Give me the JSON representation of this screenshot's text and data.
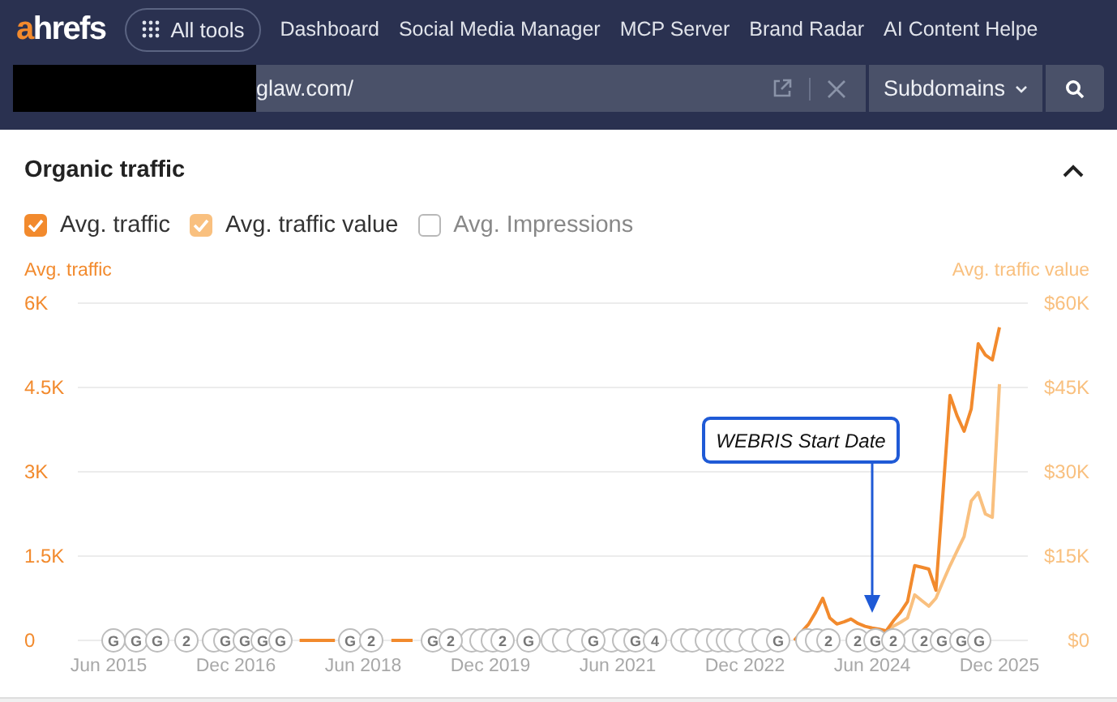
{
  "header": {
    "logo": {
      "accent": "a",
      "rest": "hrefs"
    },
    "all_tools": "All tools",
    "nav": [
      "Dashboard",
      "Social Media Manager",
      "MCP Server",
      "Brand Radar",
      "AI Content Helpe"
    ],
    "search": {
      "value": "glaw.com/",
      "mode": "Subdomains"
    }
  },
  "panel": {
    "title": "Organic traffic",
    "expanded": true,
    "legend": [
      {
        "label": "Avg. traffic",
        "checked": true,
        "color": "#f28a2d"
      },
      {
        "label": "Avg. traffic value",
        "checked": true,
        "color": "#f9c07f"
      },
      {
        "label": "Avg. Impressions",
        "checked": false,
        "color": "#b8b8b8"
      }
    ],
    "chart_data": {
      "type": "line",
      "ylabel": "Avg. traffic",
      "y2label": "Avg. traffic value",
      "categories": [
        "Jun 2015",
        null,
        null,
        null,
        null,
        null,
        null,
        null,
        null,
        null,
        null,
        null,
        null,
        null,
        null,
        null,
        null,
        null,
        "Dec 2016",
        null,
        null,
        null,
        null,
        null,
        null,
        null,
        null,
        null,
        null,
        null,
        null,
        null,
        null,
        null,
        null,
        null,
        "Jun 2018",
        null,
        null,
        null,
        null,
        null,
        null,
        null,
        null,
        null,
        null,
        null,
        null,
        null,
        null,
        null,
        null,
        null,
        "Dec 2019",
        null,
        null,
        null,
        null,
        null,
        null,
        null,
        null,
        null,
        null,
        null,
        null,
        null,
        null,
        null,
        null,
        null,
        "Jun 2021",
        null,
        null,
        null,
        null,
        null,
        null,
        null,
        null,
        null,
        null,
        null,
        null,
        null,
        null,
        null,
        null,
        null,
        "Dec 2022",
        null,
        null,
        null,
        null,
        null,
        null,
        null,
        null,
        null,
        null,
        null,
        null,
        null,
        null,
        null,
        null,
        null,
        "Jun 2024",
        null,
        null,
        null,
        null,
        null,
        null,
        null,
        null,
        null,
        null,
        null,
        null,
        null,
        null,
        null,
        null,
        null,
        "Dec 2025"
      ],
      "series": [
        {
          "color": "#f9c07f",
          "axis": "y2",
          "values": [
            null,
            null,
            null,
            null,
            null,
            null,
            null,
            null,
            null,
            null,
            null,
            null,
            null,
            null,
            null,
            null,
            null,
            null,
            null,
            null,
            null,
            null,
            null,
            null,
            null,
            null,
            null,
            null,
            null,
            null,
            null,
            null,
            null,
            null,
            null,
            null,
            null,
            null,
            null,
            null,
            null,
            null,
            null,
            null,
            null,
            null,
            null,
            null,
            null,
            null,
            null,
            null,
            null,
            null,
            null,
            null,
            null,
            null,
            null,
            null,
            null,
            null,
            null,
            null,
            null,
            null,
            null,
            null,
            null,
            null,
            null,
            null,
            null,
            null,
            null,
            null,
            null,
            null,
            null,
            null,
            null,
            null,
            null,
            null,
            null,
            null,
            null,
            null,
            null,
            null,
            null,
            null,
            null,
            null,
            null,
            null,
            null,
            null,
            null,
            null,
            null,
            null,
            null,
            null,
            null,
            null,
            null,
            null,
            null,
            0,
            1700,
            2500,
            3200,
            4000,
            8100,
            7100,
            6100,
            7500,
            10400,
            13300,
            15900,
            18500,
            24800,
            26300,
            22500,
            21900,
            45600
          ]
        },
        {
          "color": "#f28a2d",
          "values": [
            null,
            null,
            null,
            null,
            null,
            null,
            null,
            null,
            null,
            null,
            null,
            null,
            null,
            null,
            null,
            null,
            null,
            null,
            null,
            null,
            null,
            null,
            null,
            null,
            null,
            null,
            null,
            0,
            0,
            0,
            0,
            0,
            0,
            null,
            null,
            null,
            null,
            null,
            null,
            null,
            0,
            0,
            0,
            0,
            null,
            null,
            null,
            null,
            null,
            null,
            null,
            null,
            null,
            null,
            null,
            null,
            null,
            null,
            null,
            null,
            null,
            null,
            null,
            null,
            null,
            null,
            null,
            null,
            null,
            null,
            null,
            null,
            null,
            null,
            null,
            null,
            null,
            null,
            null,
            null,
            null,
            null,
            null,
            null,
            null,
            null,
            null,
            null,
            null,
            null,
            null,
            null,
            null,
            null,
            null,
            null,
            null,
            0,
            150,
            290,
            500,
            750,
            400,
            290,
            330,
            380,
            300,
            250,
            220,
            200,
            170,
            350,
            500,
            690,
            1330,
            1300,
            1270,
            890,
            2600,
            4360,
            4000,
            3720,
            4120,
            5280,
            5080,
            4990,
            5570
          ]
        }
      ],
      "grid": true,
      "ylim": [
        0,
        6000
      ],
      "y2lim": [
        0,
        60000
      ],
      "yticks": [
        {
          "value": 0,
          "label": "0"
        },
        {
          "value": 1500,
          "label": "1.5K"
        },
        {
          "value": 3000,
          "label": "3K"
        },
        {
          "value": 4500,
          "label": "4.5K"
        },
        {
          "value": 6000,
          "label": "6K"
        }
      ],
      "y2ticks": [
        {
          "value": 0,
          "label": "$0"
        },
        {
          "value": 15000,
          "label": "$15K"
        },
        {
          "value": 30000,
          "label": "$30K"
        },
        {
          "value": 45000,
          "label": "$45K"
        },
        {
          "value": 60000,
          "label": "$60K"
        }
      ],
      "annotations": [
        "WEBRIS Start Date"
      ]
    },
    "update_markers": [
      "G",
      "G",
      "G",
      "2",
      "G",
      "G",
      "G",
      "G",
      "G",
      "2",
      "G",
      "2",
      "2",
      "G",
      "G",
      "G",
      "4",
      "G",
      "2",
      "2",
      "G",
      "2",
      "2",
      "G",
      "G",
      "G"
    ]
  }
}
